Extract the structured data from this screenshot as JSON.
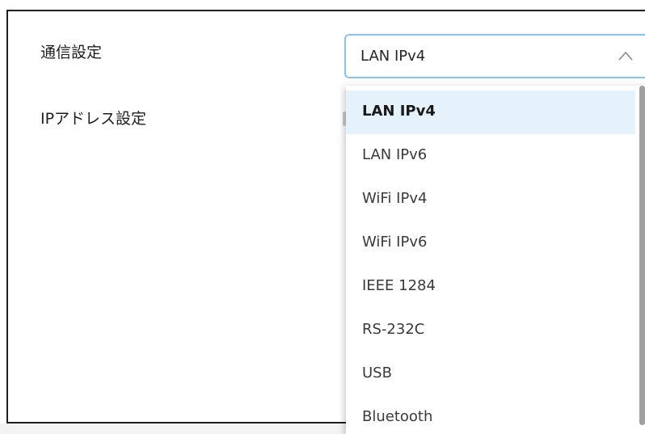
{
  "form": {
    "comm_setting_label": "通信設定",
    "ip_setting_label": "IPアドレス設定"
  },
  "select": {
    "value": "LAN IPv4",
    "expanded": true
  },
  "dropdown": {
    "options": [
      {
        "label": "LAN IPv4",
        "selected": true
      },
      {
        "label": "LAN IPv6",
        "selected": false
      },
      {
        "label": "WiFi IPv4",
        "selected": false
      },
      {
        "label": "WiFi IPv6",
        "selected": false
      },
      {
        "label": "IEEE 1284",
        "selected": false
      },
      {
        "label": "RS-232C",
        "selected": false
      },
      {
        "label": "USB",
        "selected": false
      },
      {
        "label": "Bluetooth",
        "selected": false
      }
    ]
  },
  "colors": {
    "focus_border": "#8cc2ea",
    "selected_bg": "#e5f2fb",
    "text": "#262626",
    "scrollbar": "#a0a0a0"
  },
  "icons": {
    "select_chevron": "chevron-up-icon"
  }
}
